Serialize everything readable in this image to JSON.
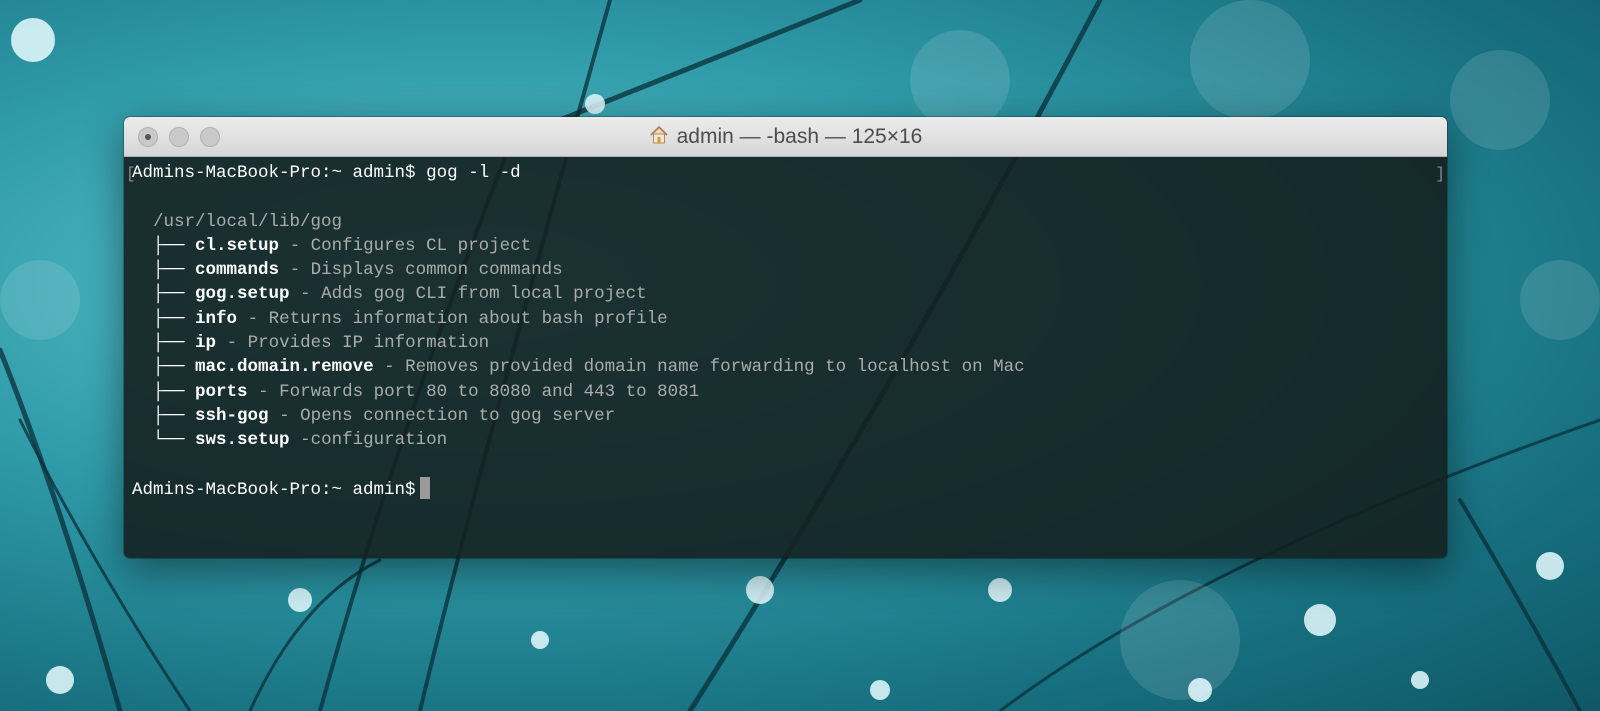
{
  "window": {
    "title": "admin — -bash — 125×16",
    "title_icon": "home-icon"
  },
  "terminal": {
    "command_line": {
      "prompt": "Admins-MacBook-Pro:~ admin$",
      "command": "gog -l -d"
    },
    "path": "/usr/local/lib/gog",
    "entries": [
      {
        "branch": "├──",
        "name": "cl.setup",
        "desc": " - Configures CL project"
      },
      {
        "branch": "├──",
        "name": "commands",
        "desc": " - Displays common commands"
      },
      {
        "branch": "├──",
        "name": "gog.setup",
        "desc": " - Adds gog CLI from local project"
      },
      {
        "branch": "├──",
        "name": "info",
        "desc": " - Returns information about bash profile"
      },
      {
        "branch": "├──",
        "name": "ip",
        "desc": " - Provides IP information"
      },
      {
        "branch": "├──",
        "name": "mac.domain.remove",
        "desc": " - Removes provided domain name forwarding to localhost on Mac"
      },
      {
        "branch": "├──",
        "name": "ports",
        "desc": " - Forwards port 80 to 8080 and 443 to 8081"
      },
      {
        "branch": "├──",
        "name": "ssh-gog",
        "desc": " - Opens connection to gog server"
      },
      {
        "branch": "└──",
        "name": "sws.setup",
        "desc": " -configuration"
      }
    ],
    "final_prompt": "Admins-MacBook-Pro:~ admin$"
  }
}
